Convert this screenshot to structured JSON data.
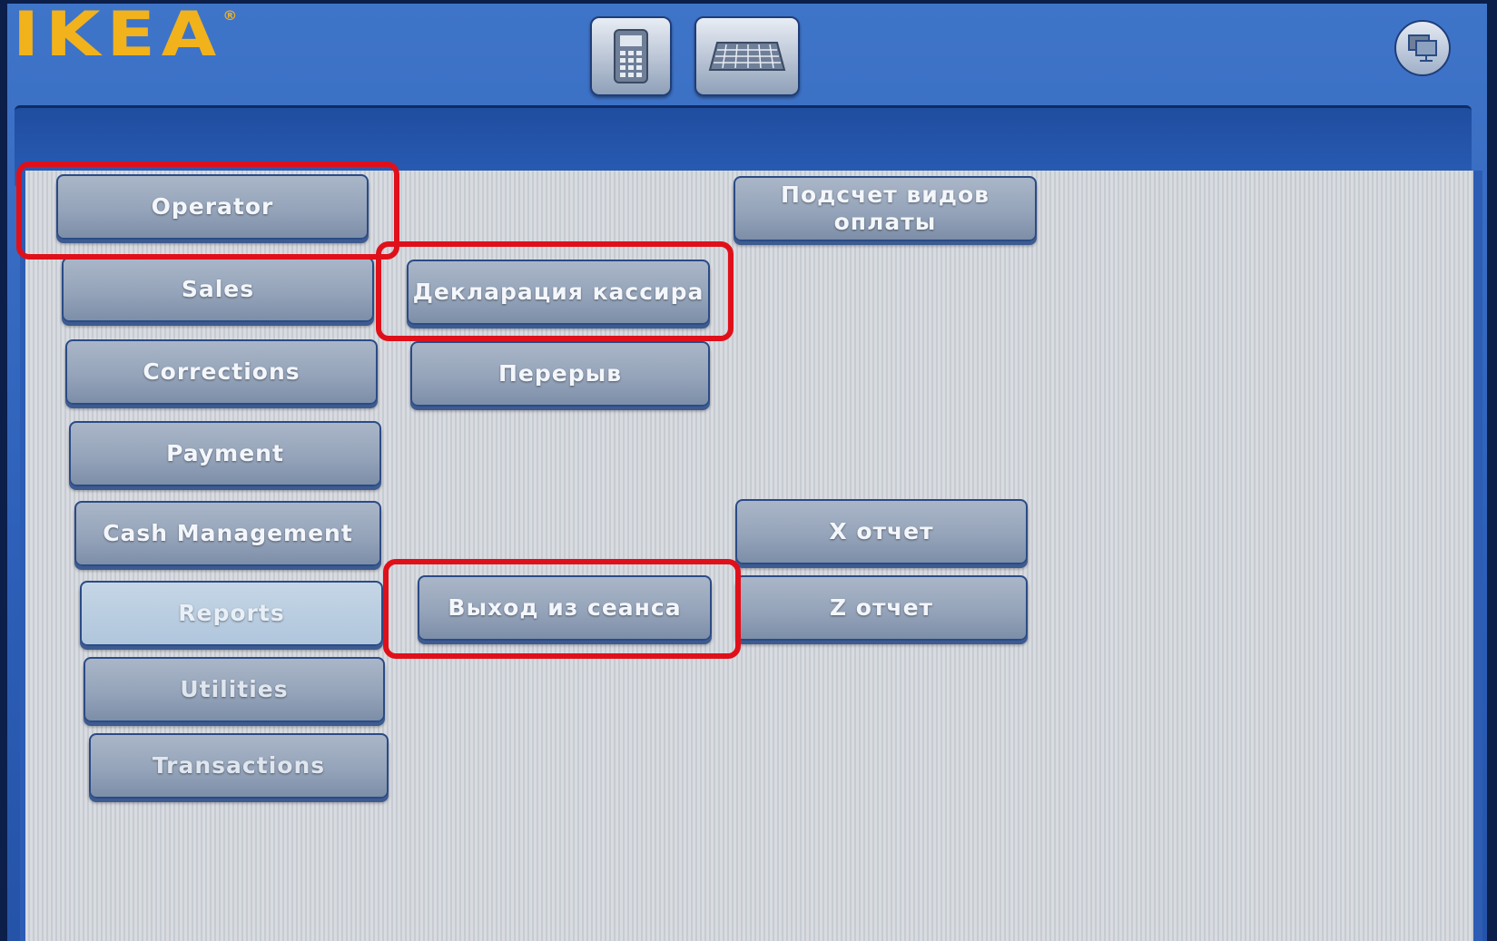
{
  "header": {
    "logo_text": "IKEA",
    "logo_mark": "®",
    "brand_color": "#f2b21c",
    "calculator_icon": "calculator-icon",
    "keyboard_icon": "keyboard-icon",
    "remote_icon": "remote-desktop-icon"
  },
  "left_menu": {
    "operator": "Operator",
    "sales": "Sales",
    "corrections": "Corrections",
    "payment": "Payment",
    "cash_management": "Cash Management",
    "reports": "Reports",
    "utilities": "Utilities",
    "transactions": "Transactions"
  },
  "middle_menu": {
    "cashier_declaration": "Декларация кассира",
    "break": "Перерыв",
    "logout": "Выход из сеанса"
  },
  "right_menu": {
    "payment_count_line1": "Подсчет видов",
    "payment_count_line2": "оплаты",
    "x_report": "X отчет",
    "z_report": "Z отчет"
  },
  "highlight_color": "#e0101a"
}
